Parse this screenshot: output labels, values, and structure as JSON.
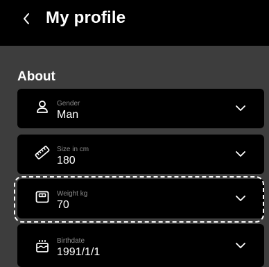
{
  "header": {
    "back_icon": "chevron-left-icon",
    "title": "My profile"
  },
  "section": {
    "title": "About"
  },
  "fields": [
    {
      "icon": "person-icon",
      "label": "Gender",
      "value": "Man"
    },
    {
      "icon": "ruler-icon",
      "label": "Size in cm",
      "value": "180"
    },
    {
      "icon": "scale-icon",
      "label": "Weight kg",
      "value": "70",
      "focused": true
    },
    {
      "icon": "cake-icon",
      "label": "Birthdate",
      "value": "1991/1/1"
    }
  ],
  "colors": {
    "background": "#3d3d3d",
    "card": "#000000",
    "label": "#8a8a8a",
    "text": "#ffffff"
  }
}
